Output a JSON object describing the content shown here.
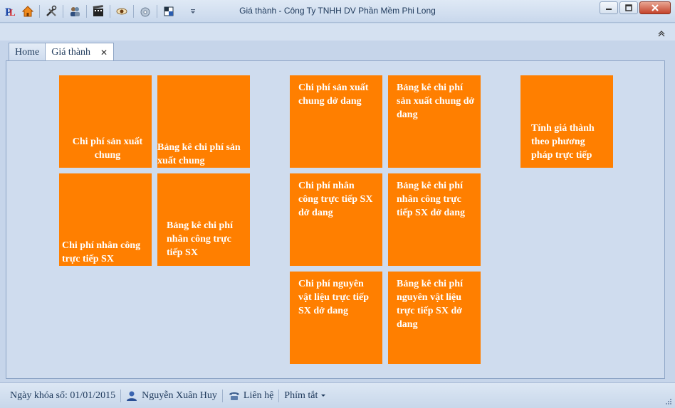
{
  "window": {
    "title": "Giá thành - Công Ty TNHH DV Phần Mềm Phi Long",
    "qat_icons": [
      "app-logo-icon",
      "home-icon",
      "tools-icon",
      "users-icon",
      "film-icon",
      "eye-icon",
      "disc-icon",
      "grid-icon",
      "qat-dropdown-icon"
    ]
  },
  "tabs": [
    {
      "label": "Home",
      "active": false
    },
    {
      "label": "Giá thành",
      "active": true,
      "close": "✕"
    }
  ],
  "tiles": {
    "cpsx_chung": "Chi phí sản xuất chung",
    "bangke_cpsx_chung": "Bảng kê chi phí sản xuất chung",
    "cp_nhancong": "Chi phí nhân công trực tiếp SX",
    "bangke_nhancong": "Bảng kê chi phí nhân công trực tiếp SX",
    "cpsx_chung_dodang": "Chi phí sản xuất chung dở dang",
    "bangke_cpsx_chung_dodang": "Bảng kê chi phí sản xuất chung dở dang",
    "cp_nhancong_dodang": "Chi phí nhân công trực tiếp SX dở dang",
    "bangke_nhancong_dodang": "Bảng kê chi phí nhân công trực tiếp SX dở dang",
    "cp_nvl_dodang": "Chi phí nguyên vật liệu trực tiếp SX dở dang",
    "bangke_nvl_dodang": "Bảng kê chi phí nguyên vật liệu trực tiếp SX dở dang",
    "tinh_gia_thanh": "Tính giá thành theo phương pháp trực tiếp"
  },
  "statusbar": {
    "lock_date": "Ngày khóa sổ: 01/01/2015",
    "user": "Nguyễn Xuân Huy",
    "contact": "Liên hệ",
    "shortcuts": "Phím tắt"
  },
  "colors": {
    "tile": "#ff7f00",
    "content_bg": "#cfdcee",
    "frame_bg": "#c6d5ea"
  }
}
